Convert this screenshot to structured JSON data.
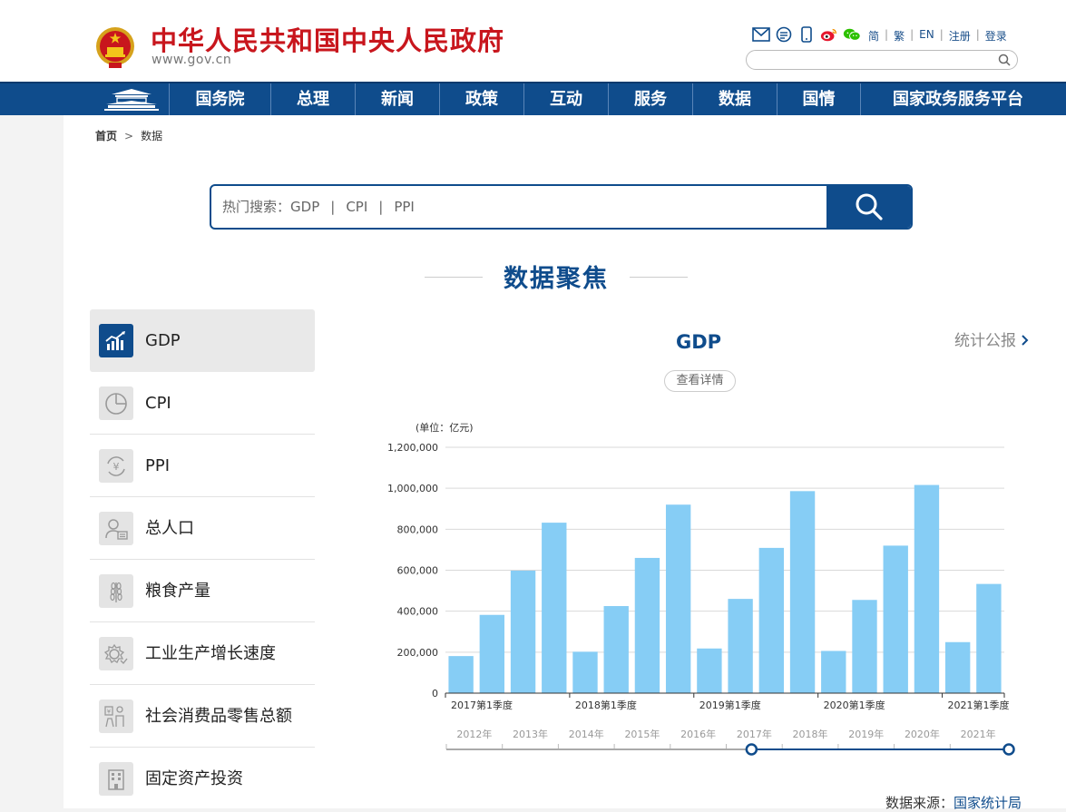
{
  "header": {
    "title": "中华人民共和国中央人民政府",
    "url": "www.gov.cn",
    "icons": [
      "mail-icon",
      "message-icon",
      "mobile-icon",
      "weibo-icon",
      "wechat-icon"
    ],
    "lang_links": [
      "简",
      "繁",
      "EN",
      "注册",
      "登录"
    ],
    "search_placeholder": ""
  },
  "nav": {
    "items": [
      "国务院",
      "总理",
      "新闻",
      "政策",
      "互动",
      "服务",
      "数据",
      "国情",
      "国家政务服务平台"
    ]
  },
  "breadcrumb": {
    "home": "首页",
    "arrow": ">",
    "current": "数据"
  },
  "data_search": {
    "hot_label": "热门搜索：",
    "hot_keywords": [
      "GDP",
      "CPI",
      "PPI"
    ],
    "separator": "|"
  },
  "section_title": "数据聚焦",
  "menu": {
    "items": [
      {
        "label": "GDP",
        "icon": "chart-trend-icon",
        "active": true
      },
      {
        "label": "CPI",
        "icon": "pie-chart-icon",
        "active": false
      },
      {
        "label": "PPI",
        "icon": "yuan-cycle-icon",
        "active": false
      },
      {
        "label": "总人口",
        "icon": "person-card-icon",
        "active": false
      },
      {
        "label": "粮食产量",
        "icon": "wheat-icon",
        "active": false
      },
      {
        "label": "工业生产增长速度",
        "icon": "gear-icon",
        "active": false
      },
      {
        "label": "社会消费品零售总额",
        "icon": "shopping-icon",
        "active": false
      },
      {
        "label": "固定资产投资",
        "icon": "building-icon",
        "active": false
      }
    ]
  },
  "chart_panel": {
    "title": "GDP",
    "stats_link": "统计公报",
    "detail_button": "查看详情",
    "source_label": "数据来源：",
    "source_link": "国家统计局"
  },
  "colors": {
    "brand_blue": "#0f4c8c",
    "title_red": "#c8161d",
    "bar": "#86cdf5"
  },
  "chart_data": {
    "type": "bar",
    "unit_label": "(单位：亿元)",
    "x_tick_labels": [
      "2017第1季度",
      "2018第1季度",
      "2019第1季度",
      "2020第1季度",
      "2021第1季度"
    ],
    "y_ticks": [
      0,
      200000,
      400000,
      600000,
      800000,
      1000000,
      1200000
    ],
    "y_tick_labels": [
      "0",
      "200,000",
      "400,000",
      "600,000",
      "800,000",
      "1,000,000",
      "1,200,000"
    ],
    "ylim": [
      0,
      1200000
    ],
    "values": [
      181000,
      382000,
      598000,
      832000,
      202000,
      425000,
      660000,
      920000,
      218000,
      460000,
      709000,
      986000,
      206000,
      455000,
      720000,
      1016000,
      249000,
      533000
    ],
    "grid": true,
    "range_slider": {
      "years": [
        "2012年",
        "2013年",
        "2014年",
        "2015年",
        "2016年",
        "2017年",
        "2018年",
        "2019年",
        "2020年",
        "2021年"
      ],
      "selected_start": "2017年",
      "selected_end": "2021年"
    }
  }
}
